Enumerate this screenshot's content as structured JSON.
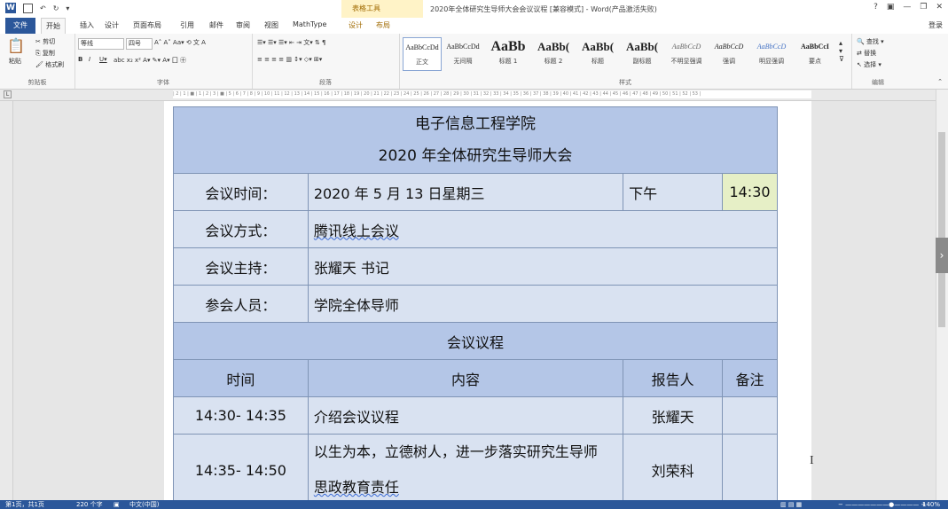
{
  "titlebar": {
    "table_tools": "表格工具",
    "document_title": "2020年全体研究生导师大会会议议程 [兼容模式] - Word(产品激活失败)",
    "help": "?",
    "sign_in": "登录"
  },
  "tabs": [
    "文件",
    "开始",
    "插入",
    "设计",
    "页面布局",
    "引用",
    "邮件",
    "审阅",
    "视图",
    "MathType",
    "设计",
    "布局"
  ],
  "ribbon": {
    "clipboard": {
      "paste": "粘贴",
      "cut": "剪切",
      "copy": "复制",
      "format_painter": "格式刷",
      "label": "剪贴板"
    },
    "font": {
      "font_name": "等线",
      "font_size": "四号",
      "label": "字体"
    },
    "paragraph": {
      "label": "段落"
    },
    "styles": {
      "items": [
        {
          "sample": "AaBbCcDd",
          "name": "正文"
        },
        {
          "sample": "AaBbCcDd",
          "name": "无间隔"
        },
        {
          "sample": "AaBb",
          "name": "标题 1"
        },
        {
          "sample": "AaBb(",
          "name": "标题 2"
        },
        {
          "sample": "AaBb(",
          "name": "标题"
        },
        {
          "sample": "AaBb(",
          "name": "副标题"
        },
        {
          "sample": "AaBbCcD",
          "name": "不明显强调"
        },
        {
          "sample": "AaBbCcD",
          "name": "强调"
        },
        {
          "sample": "AaBbCcD",
          "name": "明显强调"
        },
        {
          "sample": "AaBbCcI",
          "name": "要点"
        }
      ],
      "label": "样式"
    },
    "editing": {
      "find": "查找",
      "replace": "替换",
      "select": "选择",
      "label": "编辑"
    }
  },
  "ruler": {
    "ticks": "| 2 | 1 | ■ | 1 | 2 | 3 | ■ | 5 | 6 | 7 | 8 | 9 | 10 | 11 | 12 | 13 | 14 | 15 | 16 | 17 | 18 | 19 | 20 | 21 | 22 | 23 | 24 | 25 | 26 | 27 | 28 | 29 | 30 | 31 | 32 | 33 | 34 | 35 | 36 | 37 | 38 | 39 | 40 | 41 | 42 | 43 | 44 | 45 | 46 | 47 | 48 | 49 | 50 | 51 | 52 | 53 |"
  },
  "document": {
    "org_title": "电子信息工程学院",
    "meeting_title": "2020 年全体研究生导师大会",
    "rows": [
      {
        "label": "会议时间：",
        "value": "2020 年 5 月 13 日星期三",
        "extra": "下午",
        "time": "14:30"
      },
      {
        "label": "会议方式：",
        "value": "腾讯线上会议"
      },
      {
        "label": "会议主持：",
        "value": "张耀天 书记"
      },
      {
        "label": "参会人员：",
        "value": "学院全体导师"
      }
    ],
    "agenda_heading": "会议议程",
    "columns": [
      "时间",
      "内容",
      "报告人",
      "备注"
    ],
    "agenda": [
      {
        "time": "14:30- 14:35",
        "content": "介绍会议议程",
        "speaker": "张耀天",
        "note": ""
      },
      {
        "time": "14:35- 14:50",
        "content_line1": "以生为本，立德树人，进一步落实研究生导师",
        "content_line2": "思政教育责任",
        "speaker": "刘荣科",
        "note": ""
      }
    ]
  },
  "status": {
    "page": "第1页，共1页",
    "words": "220 个字",
    "lang": "中文(中国)",
    "zoom": "140%"
  }
}
